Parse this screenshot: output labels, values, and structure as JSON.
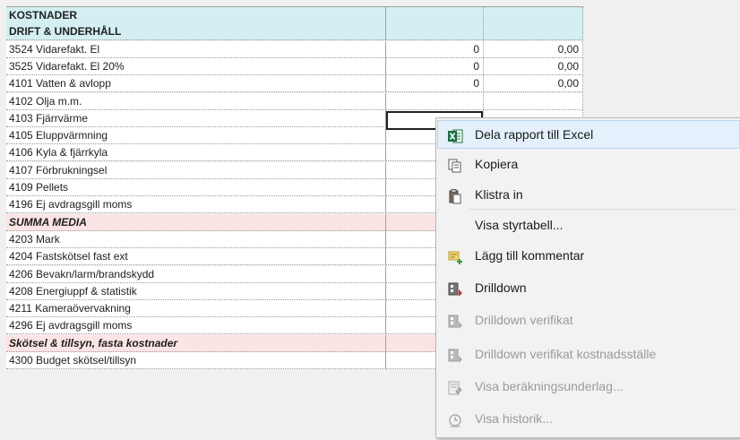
{
  "rows": [
    {
      "label": "KOSTNADER",
      "type": "hdr",
      "v1": "",
      "v2": ""
    },
    {
      "label": "DRIFT & UNDERHÅLL",
      "type": "hdr",
      "v1": "",
      "v2": ""
    },
    {
      "label": "3524 Vidarefakt. El",
      "type": "data",
      "v1": "0",
      "v2": "0,00"
    },
    {
      "label": "3525 Vidarefakt. El 20%",
      "type": "data",
      "v1": "0",
      "v2": "0,00"
    },
    {
      "label": "4101 Vatten & avlopp",
      "type": "data",
      "v1": "0",
      "v2": "0,00"
    },
    {
      "label": "4102 Olja m.m.",
      "type": "data",
      "v1": "",
      "v2": ""
    },
    {
      "label": "4103 Fjärrvärme",
      "type": "data",
      "v1": "",
      "v2": ""
    },
    {
      "label": "4105 Eluppvärmning",
      "type": "data",
      "v1": "",
      "v2": ""
    },
    {
      "label": "4106 Kyla & fjärrkyla",
      "type": "data",
      "v1": "",
      "v2": ""
    },
    {
      "label": "4107 Förbrukningsel",
      "type": "data",
      "v1": "",
      "v2": ""
    },
    {
      "label": "4109 Pellets",
      "type": "data",
      "v1": "",
      "v2": ""
    },
    {
      "label": "4196 Ej avdragsgill moms",
      "type": "data",
      "v1": "",
      "v2": ""
    },
    {
      "label": "SUMMA MEDIA",
      "type": "sum",
      "v1": "",
      "v2": ""
    },
    {
      "label": "4203 Mark",
      "type": "data",
      "v1": "",
      "v2": ""
    },
    {
      "label": "4204 Fastskötsel fast ext",
      "type": "data",
      "v1": "",
      "v2": ""
    },
    {
      "label": "4206 Bevakn/larm/brandskydd",
      "type": "data",
      "v1": "",
      "v2": ""
    },
    {
      "label": "4208 Energiuppf & statistik",
      "type": "data",
      "v1": "",
      "v2": ""
    },
    {
      "label": "4211 Kameraövervakning",
      "type": "data",
      "v1": "",
      "v2": ""
    },
    {
      "label": "4296 Ej avdragsgill moms",
      "type": "data",
      "v1": "",
      "v2": ""
    },
    {
      "label": "Skötsel & tillsyn, fasta kostnader",
      "type": "sum",
      "v1": "",
      "v2": ""
    },
    {
      "label": "4300 Budget skötsel/tillsyn",
      "type": "data",
      "v1": "",
      "v2": ""
    }
  ],
  "menu": {
    "items": [
      {
        "label": "Dela rapport till Excel",
        "icon": "excel-icon",
        "disabled": false,
        "hover": true
      },
      {
        "label": "Kopiera",
        "icon": "copy-icon",
        "disabled": false
      },
      {
        "label": "Klistra in",
        "icon": "paste-icon",
        "disabled": false
      },
      {
        "label": "Visa styrtabell...",
        "icon": "",
        "disabled": false
      },
      {
        "label": "Lägg till kommentar",
        "icon": "add-comment-icon",
        "disabled": false
      },
      {
        "label": "Drilldown",
        "icon": "drilldown-icon",
        "disabled": false
      },
      {
        "label": "Drilldown verifikat",
        "icon": "drilldown-voucher-icon",
        "disabled": true
      },
      {
        "label": "Drilldown verifikat kostnadsställe",
        "icon": "drilldown-costcenter-icon",
        "disabled": true
      },
      {
        "label": "Visa beräkningsunderlag...",
        "icon": "calculation-icon",
        "disabled": true
      },
      {
        "label": "Visa historik...",
        "icon": "history-icon",
        "disabled": true
      }
    ]
  },
  "colors": {
    "header": "#d4eff1",
    "sum": "#fde4e4",
    "menu_hover": "#e4f0fb",
    "excel": "#1e7145"
  }
}
